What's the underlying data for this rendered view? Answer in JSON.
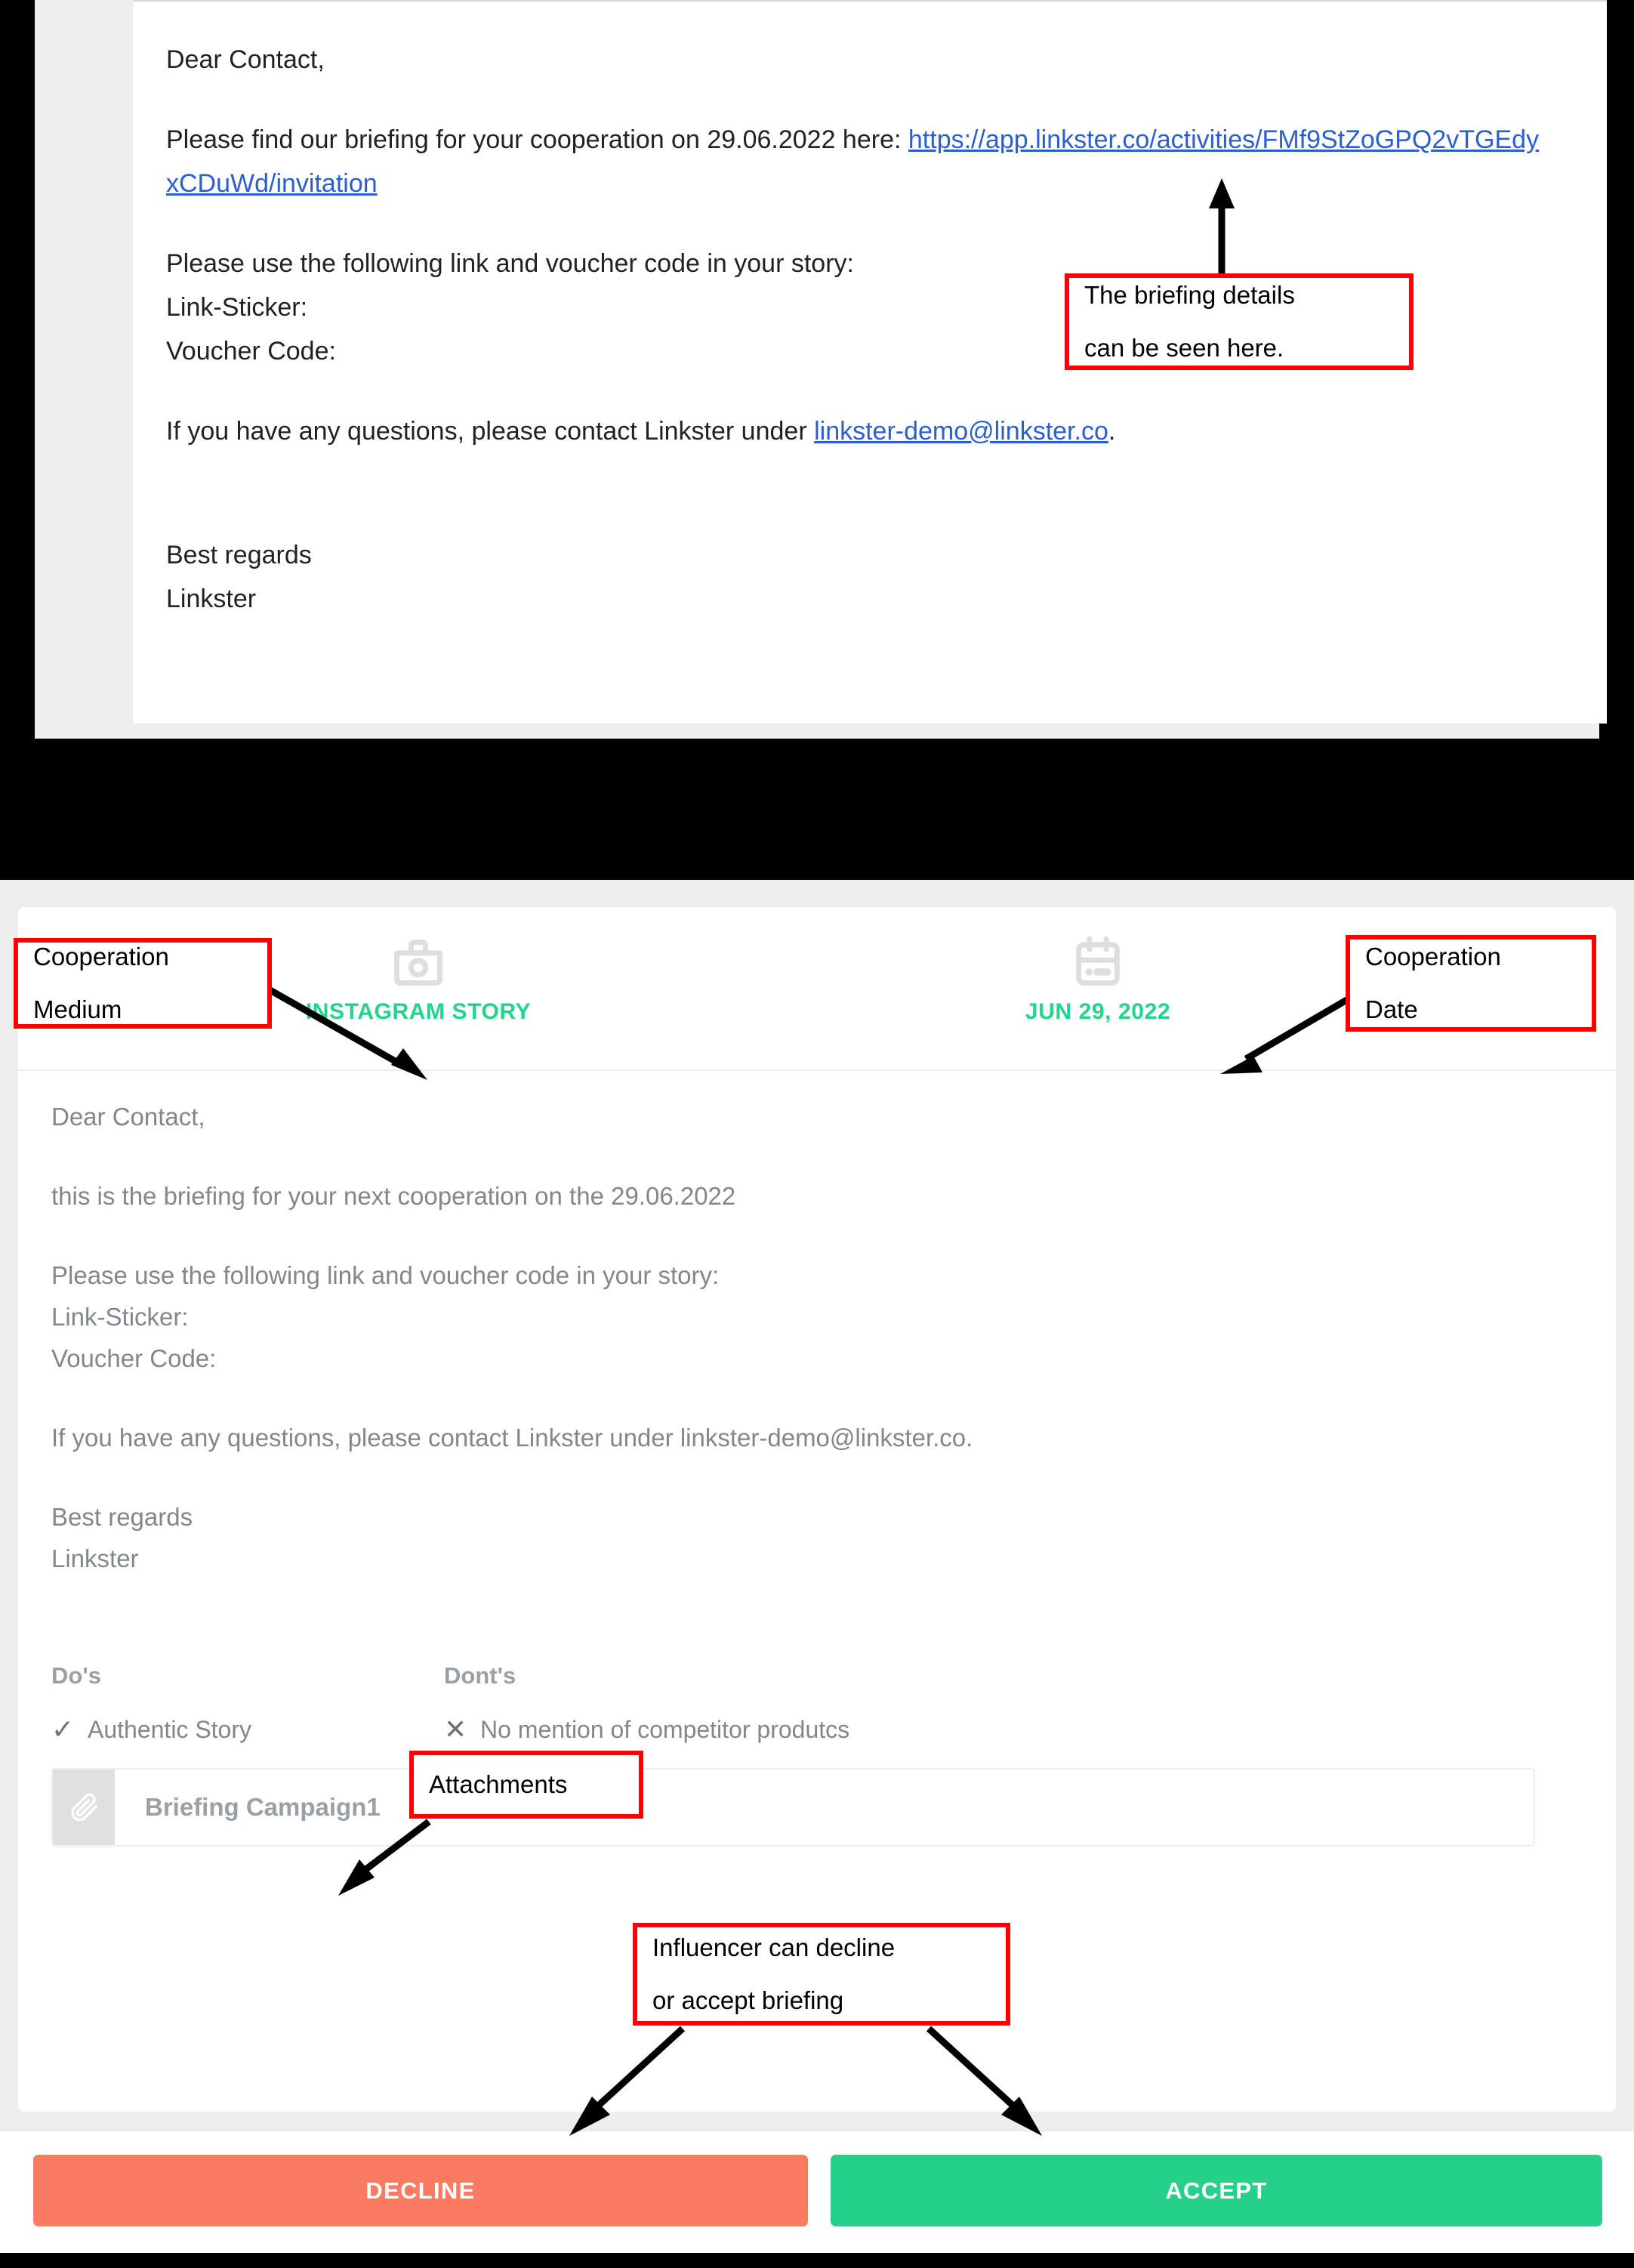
{
  "email": {
    "greeting": "Dear Contact,",
    "intro_prefix": "Please find our briefing for your cooperation on 29.06.2022 here: ",
    "link_text": "https://app.linkster.co/activities/FMf9StZoGPQ2vTGEdyxCDuWd/invitation",
    "instruction": "Please use the following link and voucher code in your story:",
    "link_sticker_label": "Link-Sticker:",
    "voucher_code_label": "Voucher Code:",
    "contact_prefix": "If you have any questions, please contact Linkster under ",
    "contact_email": "linkster-demo@linkster.co",
    "contact_suffix": ".",
    "signoff_1": "Best regards",
    "signoff_2": "Linkster"
  },
  "app": {
    "meta": {
      "medium_icon": "camera-icon",
      "medium_value": "INSTAGRAM STORY",
      "date_icon": "calendar-icon",
      "date_value": "JUN 29, 2022",
      "accent_color": "#22d58a"
    },
    "body": {
      "greeting": "Dear Contact,",
      "intro": "this is the briefing for your next cooperation on the 29.06.2022",
      "instruction": "Please use the following link and voucher code in your story:",
      "link_sticker_label": "Link-Sticker:",
      "voucher_code_label": "Voucher Code:",
      "contact": "If you have any questions, please contact Linkster under linkster-demo@linkster.co.",
      "signoff_1": "Best regards",
      "signoff_2": "Linkster"
    },
    "rules": {
      "dos_heading": "Do's",
      "donts_heading": "Dont's",
      "dos_mark": "✓",
      "donts_mark": "✕",
      "dos_items": [
        "Authentic Story"
      ],
      "donts_items": [
        "No mention of competitor produtcs"
      ]
    },
    "attachment": {
      "icon": "paperclip-icon",
      "name": "Briefing Campaign1"
    },
    "footer": {
      "decline_label": "DECLINE",
      "accept_label": "ACCEPT",
      "decline_color": "#fb7a62",
      "accept_color": "#25d08a"
    }
  },
  "annotations": {
    "briefing_details": [
      "The briefing details",
      "can be seen here."
    ],
    "cooperation_medium": [
      "Cooperation",
      "Medium"
    ],
    "cooperation_date": [
      "Cooperation",
      "Date"
    ],
    "attachments": [
      "Attachments"
    ],
    "decline_accept": [
      "Influencer can decline",
      "or accept briefing"
    ],
    "border_color": "#ff0000"
  }
}
